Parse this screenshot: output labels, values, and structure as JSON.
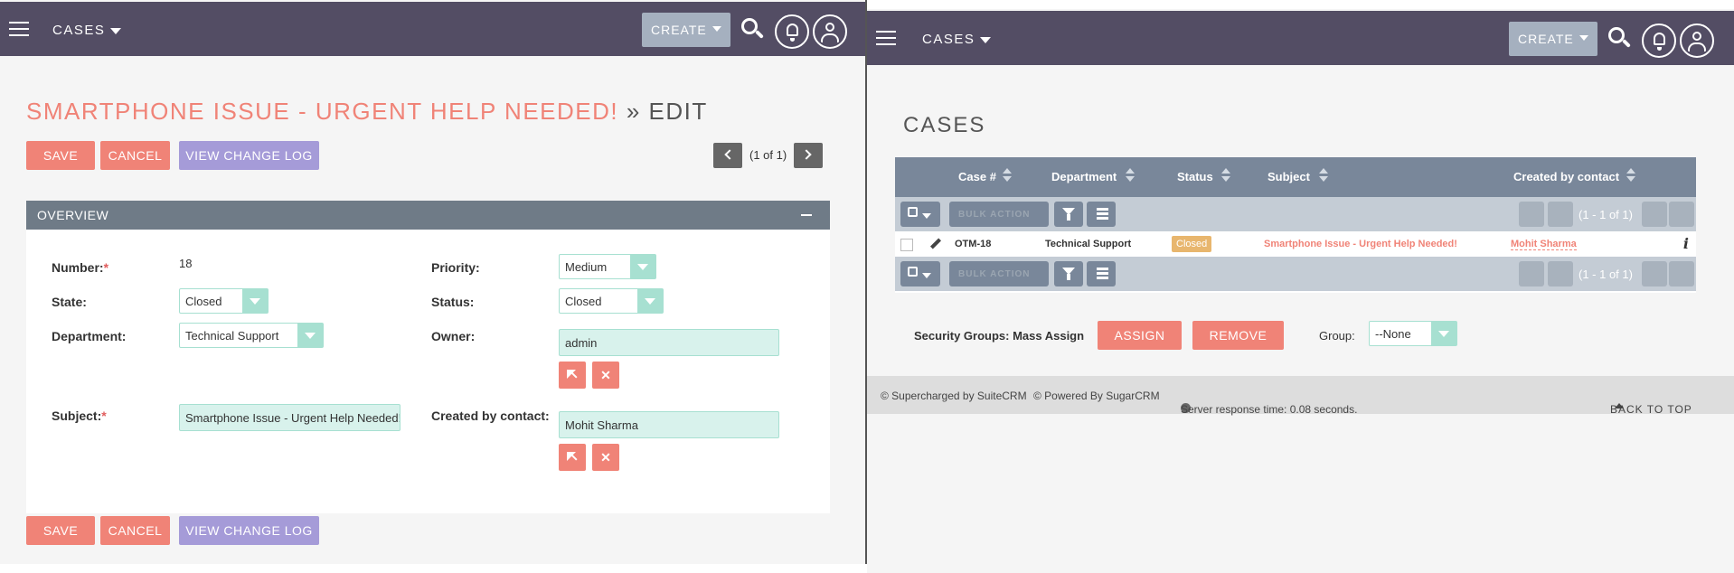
{
  "left": {
    "header": {
      "module": "CASES",
      "create_label": "CREATE"
    },
    "title": "SMARTPHONE ISSUE - URGENT HELP NEEDED!",
    "title_suffix": "» EDIT",
    "buttons": {
      "save": "SAVE",
      "cancel": "CANCEL",
      "change_log": "VIEW CHANGE LOG"
    },
    "pager": "(1 of 1)",
    "panel": {
      "title": "OVERVIEW",
      "fields": {
        "number": {
          "label": "Number:",
          "value": "18"
        },
        "priority": {
          "label": "Priority:",
          "value": "Medium"
        },
        "state": {
          "label": "State:",
          "value": "Closed"
        },
        "status": {
          "label": "Status:",
          "value": "Closed"
        },
        "department": {
          "label": "Department:",
          "value": "Technical Support"
        },
        "owner": {
          "label": "Owner:",
          "value": "admin"
        },
        "subject": {
          "label": "Subject:",
          "value": "Smartphone Issue - Urgent Help Needed!"
        },
        "created_by_contact": {
          "label": "Created by contact:",
          "value": "Mohit Sharma"
        }
      },
      "required_mark": "*",
      "clear_glyph": "✕"
    }
  },
  "right": {
    "header": {
      "module": "CASES",
      "create_label": "CREATE"
    },
    "title": "CASES",
    "columns": [
      "Case #",
      "Department",
      "Status",
      "Subject",
      "Created by contact"
    ],
    "bulk_action": "BULK ACTION",
    "pager_text": "(1 - 1 of 1)",
    "rows": [
      {
        "case": "OTM-18",
        "department": "Technical Support",
        "status": "Closed",
        "subject": "Smartphone Issue - Urgent Help Needed!",
        "contact": "Mohit Sharma"
      }
    ],
    "info_glyph": "i",
    "mass_assign": {
      "label": "Security Groups: Mass Assign",
      "assign": "ASSIGN",
      "remove": "REMOVE",
      "group_label": "Group:",
      "group_value": "--None"
    },
    "footer": {
      "supercharged": "© Supercharged by SuiteCRM",
      "powered": "© Powered By SugarCRM",
      "response": "Server response time: 0.08 seconds.",
      "back_to_top": "BACK TO TOP"
    }
  },
  "colors": {
    "header": "#534d64",
    "accent": "#f08377",
    "purple": "#a59bd8",
    "teal": "#a7e0d1",
    "status_badge": "#e8b66e"
  }
}
